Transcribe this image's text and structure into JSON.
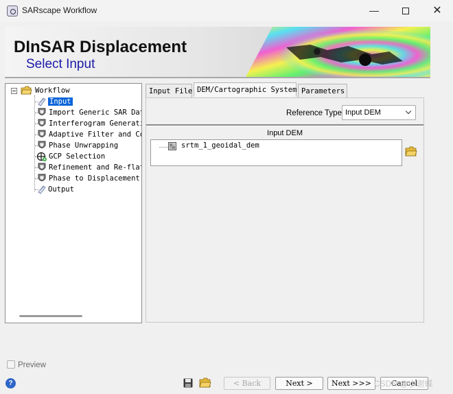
{
  "window": {
    "title": "SARscape Workflow",
    "min_glyph": "—",
    "close_glyph": "✕"
  },
  "banner": {
    "title": "DInSAR Displacement",
    "subtitle": "Select Input"
  },
  "tree": {
    "root_label": "Workflow",
    "items": [
      {
        "label": "Input",
        "icon": "input-icon",
        "selected": true
      },
      {
        "label": "Import Generic SAR Data",
        "icon": "step-icon"
      },
      {
        "label": "Interferogram Generation",
        "icon": "step-icon"
      },
      {
        "label": "Adaptive Filter and Coherence",
        "icon": "step-icon"
      },
      {
        "label": "Phase Unwrapping",
        "icon": "step-icon"
      },
      {
        "label": "GCP Selection",
        "icon": "gcp-icon"
      },
      {
        "label": "Refinement and Re-flattening",
        "icon": "step-icon"
      },
      {
        "label": "Phase to Displacement Conversion",
        "icon": "step-icon"
      },
      {
        "label": "Output",
        "icon": "output-icon"
      }
    ]
  },
  "tabs": [
    {
      "label": "Input File",
      "active": false
    },
    {
      "label": "DEM/Cartographic System",
      "active": true
    },
    {
      "label": "Parameters",
      "active": false
    }
  ],
  "dem_tab": {
    "reference_type_label": "Reference Type",
    "reference_type_value": "Input DEM",
    "group_label": "Input DEM",
    "files": [
      "srtm_1_geoidal_dem"
    ]
  },
  "footer": {
    "preview_label": "Preview",
    "preview_checked": false,
    "help_glyph": "?",
    "back_label": "< Back",
    "next_label": "Next >",
    "next_all_label": "Next >>>",
    "cancel_label": "Cancel",
    "watermark": "CSDN @小谢蝶"
  },
  "colors": {
    "selection": "#0a64d8",
    "subtitle": "#1a1aa8",
    "help": "#2e66c8"
  }
}
